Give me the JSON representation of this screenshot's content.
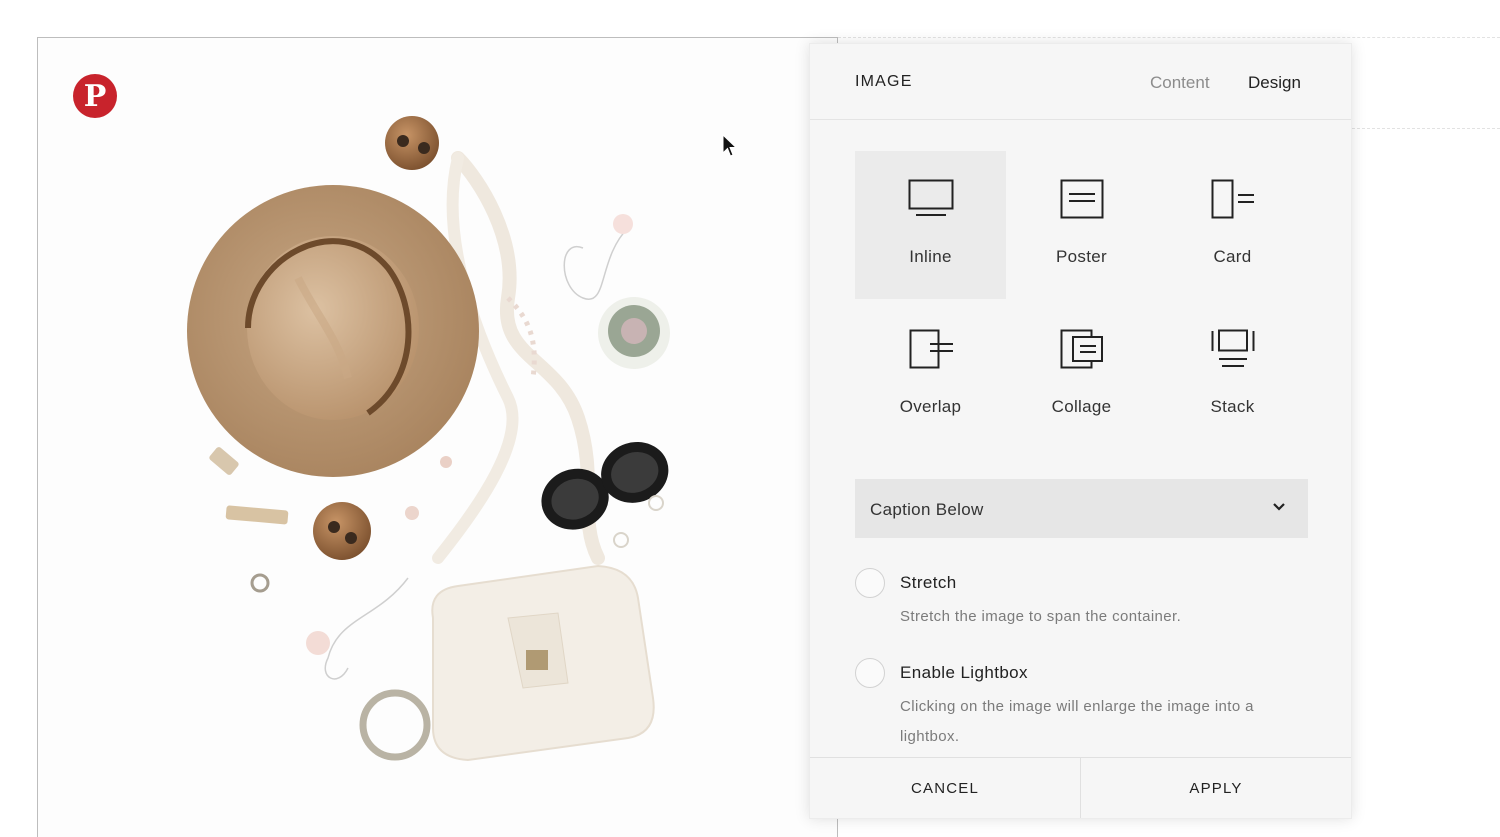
{
  "canvas": {
    "pin_icon": "pinterest-icon",
    "pin_letter": "P"
  },
  "panel": {
    "title": "IMAGE",
    "tabs": [
      {
        "label": "Content",
        "active": false
      },
      {
        "label": "Design",
        "active": true
      }
    ],
    "layouts": [
      {
        "label": "Inline",
        "icon": "inline-layout-icon",
        "selected": true
      },
      {
        "label": "Poster",
        "icon": "poster-layout-icon",
        "selected": false
      },
      {
        "label": "Card",
        "icon": "card-layout-icon",
        "selected": false
      },
      {
        "label": "Overlap",
        "icon": "overlap-layout-icon",
        "selected": false
      },
      {
        "label": "Collage",
        "icon": "collage-layout-icon",
        "selected": false
      },
      {
        "label": "Stack",
        "icon": "stack-layout-icon",
        "selected": false
      }
    ],
    "caption_select": {
      "value": "Caption Below"
    },
    "options": [
      {
        "title": "Stretch",
        "desc": "Stretch the image to span the container.",
        "checked": false
      },
      {
        "title": "Enable Lightbox",
        "desc": "Clicking on the image will enlarge the image into a lightbox.",
        "checked": false
      }
    ],
    "footer": {
      "cancel": "CANCEL",
      "apply": "APPLY"
    }
  },
  "colors": {
    "panel_bg": "#f6f6f6",
    "selected_tile": "#ebebeb",
    "select_bg": "#e6e6e6",
    "pinterest_red": "#c8232c"
  }
}
